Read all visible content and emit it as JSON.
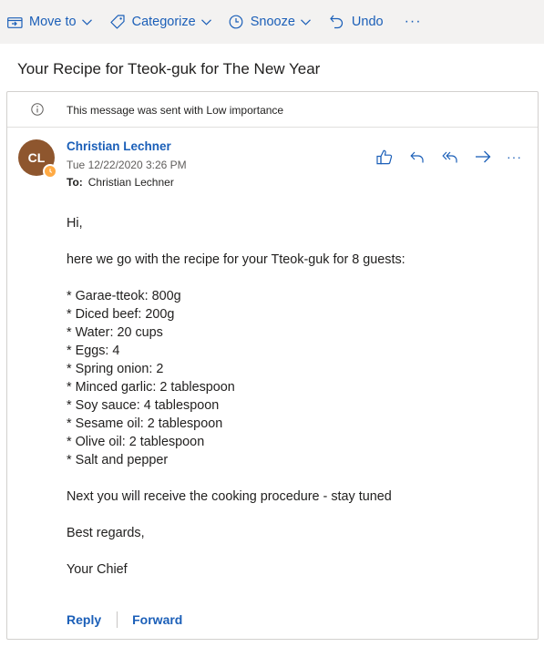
{
  "toolbar": {
    "move_to": "Move to",
    "categorize": "Categorize",
    "snooze": "Snooze",
    "undo": "Undo",
    "more": "···"
  },
  "subject": "Your Recipe for Tteok-guk for The New Year",
  "info_bar": "This message was sent with Low importance",
  "sender": {
    "initials": "CL",
    "name": "Christian Lechner",
    "date": "Tue 12/22/2020 3:26 PM",
    "to_label": "To:",
    "to_value": "Christian Lechner"
  },
  "actions_more": "···",
  "message": {
    "greeting": "Hi,",
    "intro": "here we go with the recipe for your Tteok-guk for 8 guests:",
    "ingredients": [
      "* Garae-tteok: 800g",
      "* Diced beef: 200g",
      "* Water: 20 cups",
      "* Eggs: 4",
      "* Spring onion: 2",
      "* Minced garlic: 2 tablespoon",
      "* Soy sauce: 4 tablespoon",
      "* Sesame oil: 2 tablespoon",
      "* Olive oil: 2 tablespoon",
      "* Salt and pepper"
    ],
    "next": "Next you will receive the cooking procedure - stay tuned",
    "closing": "Best regards,",
    "signature": "Your Chief"
  },
  "footer": {
    "reply": "Reply",
    "forward": "Forward"
  },
  "colors": {
    "accent": "#1b5fb8",
    "avatar": "#8e562e",
    "presence": "#ffaa44",
    "toolbar_bg": "#f3f2f1"
  }
}
